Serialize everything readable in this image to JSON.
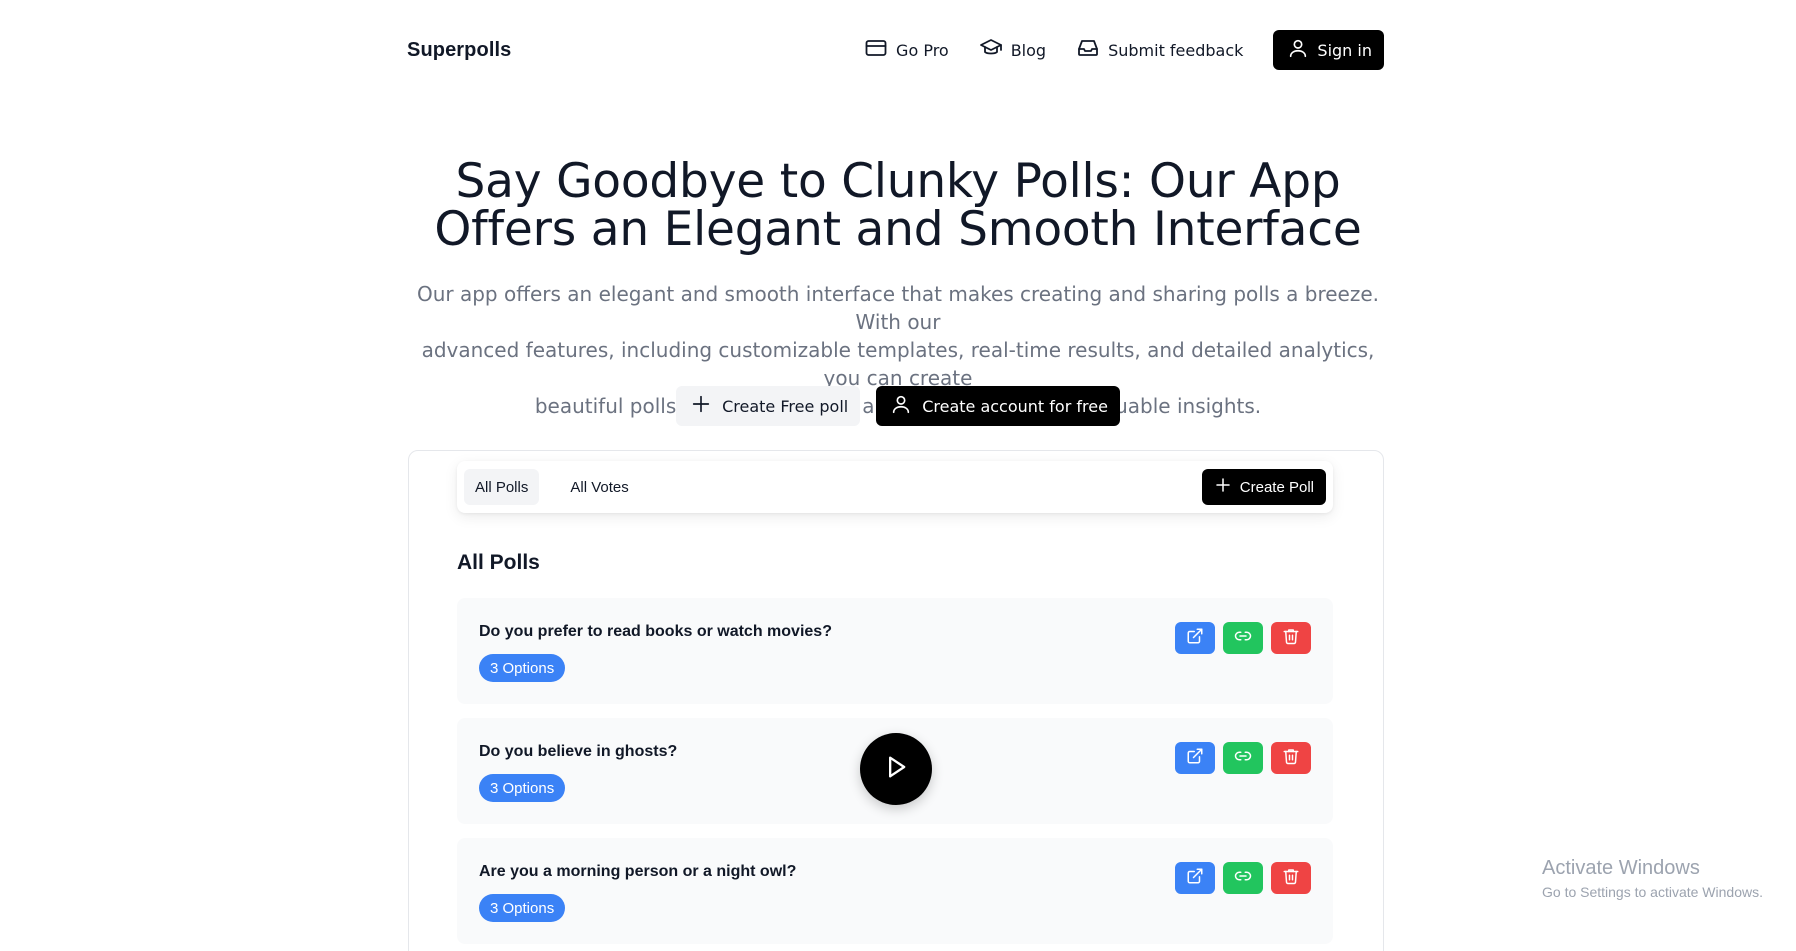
{
  "header": {
    "brand": "Superpolls",
    "nav": [
      {
        "label": "Go Pro",
        "icon": "credit-card-icon"
      },
      {
        "label": "Blog",
        "icon": "graduation-cap-icon"
      },
      {
        "label": "Submit feedback",
        "icon": "inbox-icon"
      }
    ],
    "sign_in": "Sign in"
  },
  "hero": {
    "title_line1": "Say Goodbye to Clunky Polls: Our App",
    "title_line2": "Offers an Elegant and Smooth Interface",
    "subtitle_line1": "Our app offers an elegant and smooth interface that makes creating and sharing polls a breeze. With our",
    "subtitle_line2": "advanced features, including customizable templates, real-time results, and detailed analytics, you can create",
    "subtitle_line3": "beautiful polls that engage your audience and provide valuable insights.",
    "create_free_poll": "Create Free poll",
    "create_account": "Create account for free"
  },
  "demo": {
    "tabs": [
      {
        "label": "All Polls",
        "active": true
      },
      {
        "label": "All Votes",
        "active": false
      }
    ],
    "create_poll": "Create Poll",
    "section_title": "All Polls",
    "polls": [
      {
        "question": "Do you prefer to read books or watch movies?",
        "options": "3 Options"
      },
      {
        "question": "Do you believe in ghosts?",
        "options": "3 Options"
      },
      {
        "question": "Are you a morning person or a night owl?",
        "options": "3 Options"
      }
    ]
  },
  "watermark": {
    "line1": "Activate Windows",
    "line2": "Go to Settings to activate Windows."
  },
  "colors": {
    "primary_dark": "#000000",
    "badge_blue": "#3b82f6",
    "open_blue": "#3b82f6",
    "link_green": "#22c55e",
    "delete_red": "#ef4444"
  }
}
